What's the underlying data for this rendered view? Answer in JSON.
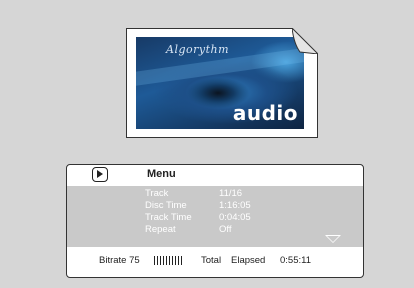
{
  "artwork": {
    "brand_text": "Algorythm",
    "label": "audio"
  },
  "menu": {
    "title": "Menu",
    "rows": [
      {
        "key": "Track",
        "value": "11/16"
      },
      {
        "key": "Disc Time",
        "value": "1:16:05"
      },
      {
        "key": "Track Time",
        "value": "0:04:05"
      },
      {
        "key": "Repeat",
        "value": "Off"
      }
    ]
  },
  "status": {
    "bitrate_label": "Bitrate 75",
    "total_label": "Total",
    "elapsed_label": "Elapsed",
    "elapsed_time": "0:55:11"
  },
  "colors": {
    "background": "#d6d6d6",
    "panel_info": "#c9c9c9",
    "info_text": "#ffffff"
  }
}
